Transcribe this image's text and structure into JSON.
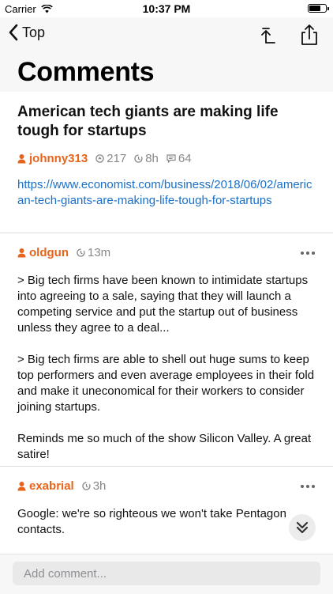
{
  "status_bar": {
    "carrier": "Carrier",
    "time": "10:37 PM",
    "battery_level": 0.8
  },
  "nav": {
    "back_label": "Top",
    "back_icon": "chevron-left-icon",
    "scroll_top_icon": "scroll-to-top-icon",
    "share_icon": "share-icon"
  },
  "page": {
    "title": "Comments"
  },
  "story": {
    "title": "American tech giants are making life tough for startups",
    "author": "johnny313",
    "points": "217",
    "age": "8h",
    "comment_count": "64",
    "url": "https://www.economist.com/business/2018/06/02/american-tech-giants-are-making-life-tough-for-startups"
  },
  "comments": [
    {
      "author": "oldgun",
      "age": "13m",
      "paragraphs": [
        "> Big tech firms have been known to intimidate startups into agreeing to a sale, saying that they will launch a competing service and put the startup out of business unless they agree to a deal...",
        "> Big tech firms are able to shell out huge sums to keep top performers and even average employees in their fold and make it uneconomical for their workers to consider joining startups.",
        "Reminds me so much of the show Silicon Valley. A great satire!"
      ]
    },
    {
      "author": "exabrial",
      "age": "3h",
      "paragraphs": [
        "Google: we're so righteous we won't take Pentagon contacts."
      ]
    }
  ],
  "footer": {
    "placeholder": "Add comment..."
  },
  "colors": {
    "accent": "#e8641b",
    "link": "#1a6fc9",
    "meta": "#888888"
  }
}
